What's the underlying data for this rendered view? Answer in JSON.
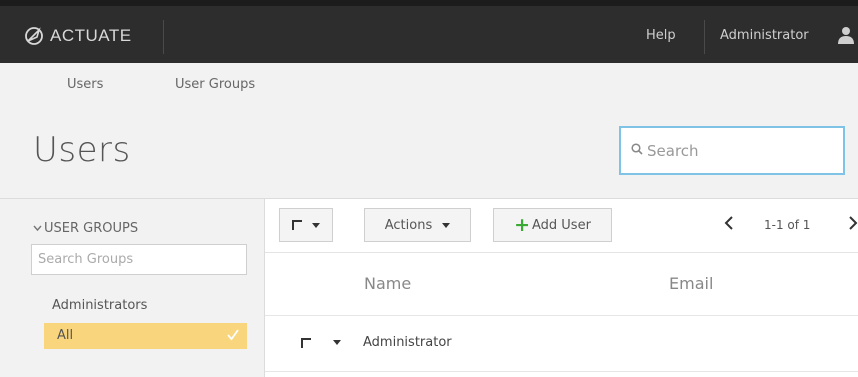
{
  "topbar": {
    "logo_text": "ACTUATE",
    "help": "Help",
    "user": "Administrator"
  },
  "nav": {
    "users": "Users",
    "user_groups": "User Groups"
  },
  "page": {
    "title": "Users"
  },
  "search": {
    "placeholder": "Search"
  },
  "sidebar": {
    "header": "USER GROUPS",
    "search_placeholder": "Search Groups",
    "groups": [
      {
        "label": "Administrators",
        "selected": false
      },
      {
        "label": "All",
        "selected": true
      }
    ]
  },
  "toolbar": {
    "actions_label": "Actions",
    "add_user_label": "Add User",
    "pager_text": "1-1 of 1"
  },
  "table": {
    "columns": [
      "Name",
      "Email"
    ],
    "rows": [
      {
        "name": "Administrator",
        "email": ""
      }
    ]
  },
  "colors": {
    "topbar": "#2d2d2d",
    "selected_group": "#f9d57d",
    "add_plus": "#3aaa35",
    "search_border": "#7fc3e6"
  }
}
